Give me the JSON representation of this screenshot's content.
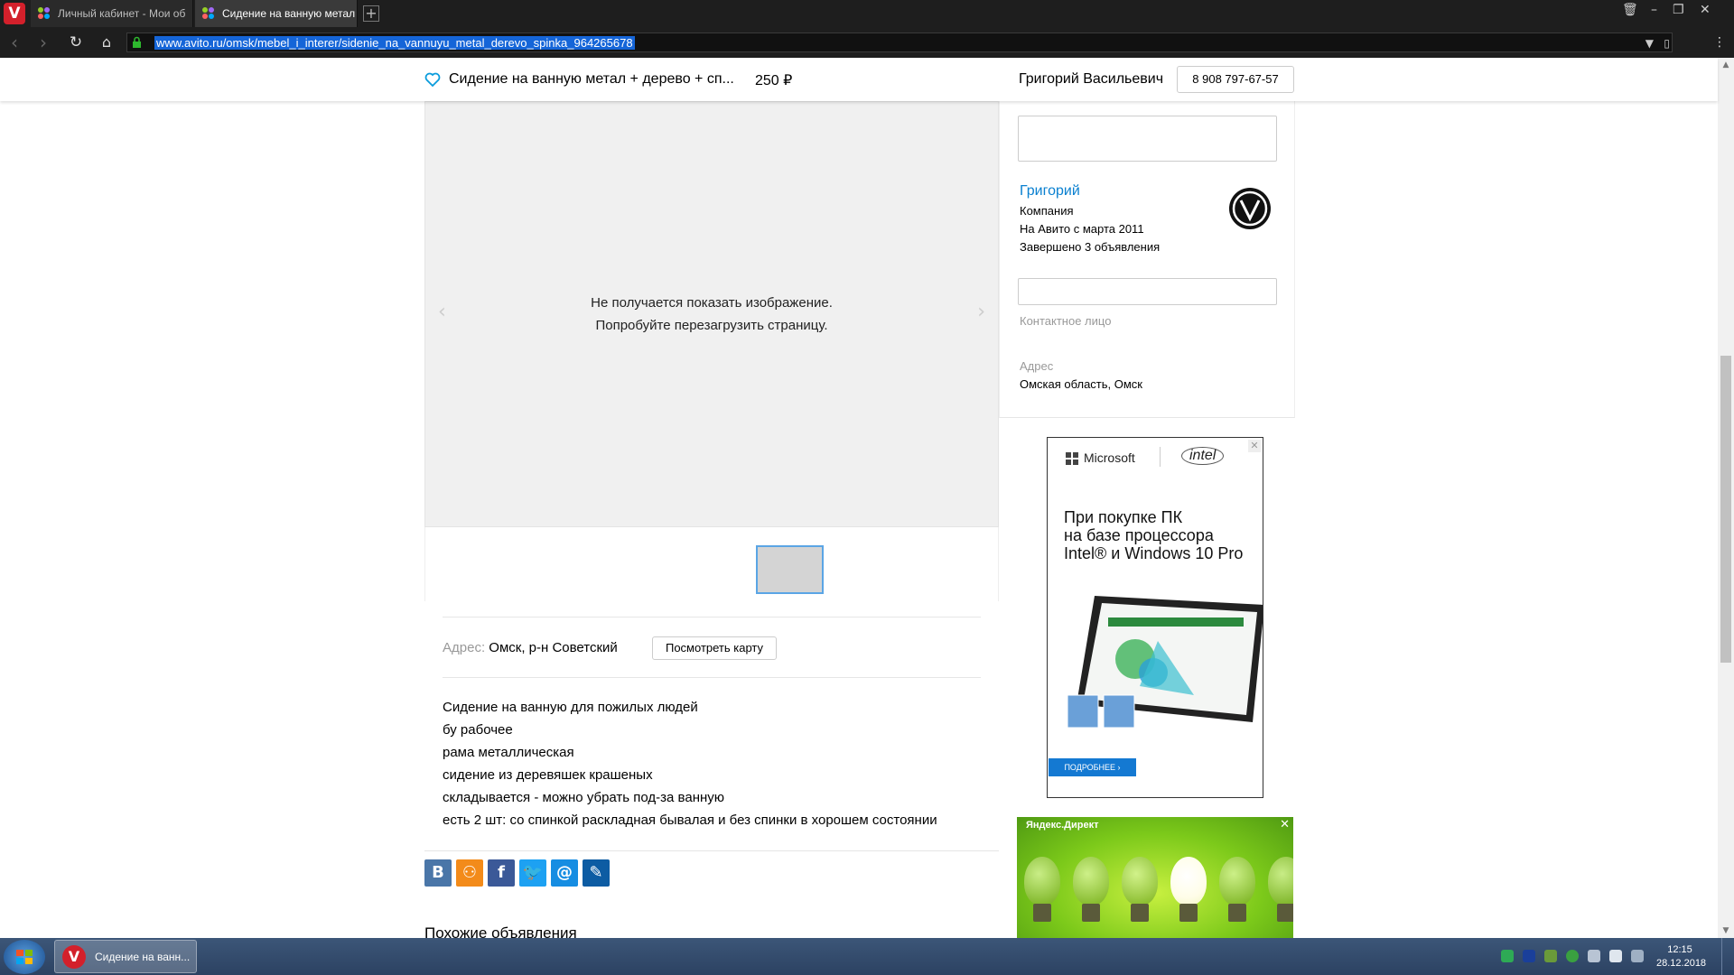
{
  "browser": {
    "logo": "V",
    "tabs": [
      {
        "label": "Личный кабинет - Мои об",
        "icon": "avito-icon",
        "active": false
      },
      {
        "label": "Сидение на ванную метал",
        "icon": "avito-icon",
        "active": true
      }
    ],
    "new_tab_label": "+",
    "url": "www.avito.ru/omsk/mebel_i_interer/sidenie_na_vannuyu_metal_derevo_spinka_964265678"
  },
  "sticky_header": {
    "title": "Сидение на ванную метал + дерево + сп...",
    "price": "250 ₽",
    "seller": "Григорий Васильевич",
    "phone": "8 908 797-67-57"
  },
  "gallery": {
    "error_line1": "Не получается показать изображение.",
    "error_line2": "Попробуйте перезагрузить страницу.",
    "prev_arrow": "‹",
    "next_arrow": "›"
  },
  "address": {
    "label": "Адрес:",
    "value": "Омск, р-н Советский",
    "map_button": "Посмотреть карту"
  },
  "description": [
    "Сидение на ванную для пожилых людей",
    "бу рабочее",
    "рама металлическая",
    "сидение из деревяшек крашеных",
    "складывается - можно убрать под-за ванную",
    "есть 2 шт: со спинкой раскладная бывалая и без спинки в хорошем состоянии"
  ],
  "share": {
    "vk": "В",
    "ok": "ok-icon",
    "facebook": "f",
    "twitter": "twitter-icon",
    "mail": "@",
    "livejournal": "livejournal-icon"
  },
  "similar_heading": "Похожие объявления",
  "seller_panel": {
    "name": "Григорий",
    "type": "Компания",
    "since": "На Авито с марта 2011",
    "completed": "Завершено 3 объявления",
    "contact_label": "Контактное лицо",
    "address_label": "Адрес",
    "address_value": "Омская область, Омск"
  },
  "ad_intel": {
    "brand1": "Microsoft",
    "brand2": "intel",
    "headline_line1": "При покупке ПК",
    "headline_line2": "на базе процессора",
    "headline_line3": "Intel® и Windows 10 Pro",
    "cta": "ПОДРОБНЕЕ ›",
    "close": "✕"
  },
  "ad_yandex": {
    "label": "Яндекс.Директ",
    "close": "✕"
  },
  "taskbar": {
    "item_label": "Сидение на ванн...",
    "time": "12:15",
    "date": "28.12.2018"
  },
  "colors": {
    "link_blue": "#0a80d0",
    "url_highlight": "#1565d8",
    "thumb_border": "#5aa5e5"
  }
}
